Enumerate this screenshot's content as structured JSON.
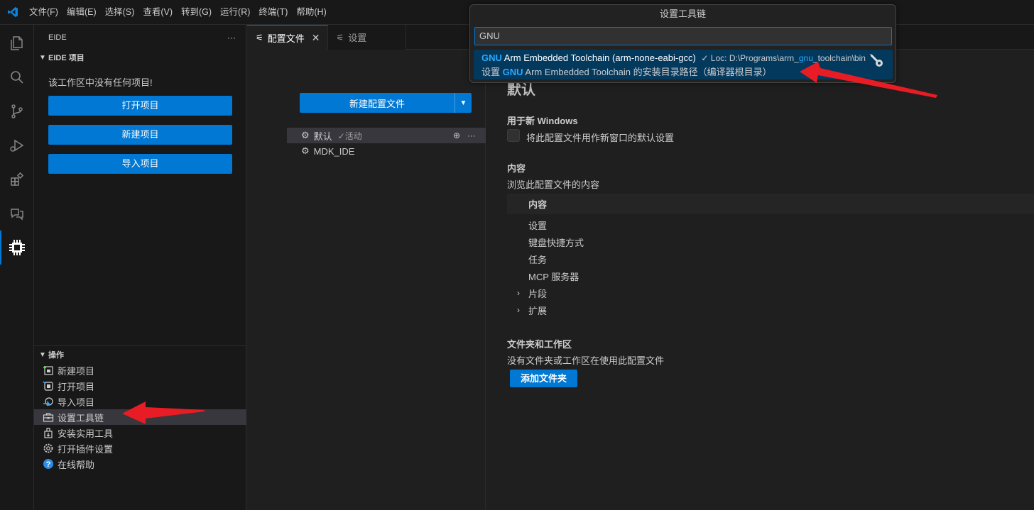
{
  "menubar": {
    "items": [
      "文件(F)",
      "编辑(E)",
      "选择(S)",
      "查看(V)",
      "转到(G)",
      "运行(R)",
      "终端(T)",
      "帮助(H)"
    ]
  },
  "activity_bar": {
    "icons": [
      "files-icon",
      "search-icon",
      "source-control-icon",
      "run-debug-icon",
      "extensions-icon",
      "chat-icon",
      "eide-chip-icon"
    ],
    "accent": "#0078d4"
  },
  "sidebar": {
    "title": "EIDE",
    "more": "···",
    "project_section": {
      "header": "EIDE 项目",
      "empty_message": "该工作区中没有任何项目!",
      "buttons": [
        "打开项目",
        "新建项目",
        "导入项目"
      ]
    },
    "ops_section": {
      "header": "操作",
      "items": [
        "新建项目",
        "打开项目",
        "导入项目",
        "设置工具链",
        "安装实用工具",
        "打开插件设置",
        "在线帮助"
      ]
    }
  },
  "editor": {
    "tabs": [
      {
        "label": "配置文件",
        "close": "✕"
      },
      {
        "label": "设置"
      }
    ],
    "profiles": {
      "new_button": "新建配置文件",
      "list": [
        {
          "name": "默认",
          "tag": "✓活动"
        },
        {
          "name": "MDK_IDE"
        }
      ],
      "row_actions": [
        "⊕",
        "···"
      ]
    },
    "details": {
      "profile_name": "默认",
      "new_windows_heading": "用于新 Windows",
      "new_windows_checkbox": "将此配置文件用作新窗口的默认设置",
      "contents_heading": "内容",
      "contents_desc": "浏览此配置文件的内容",
      "contents_table_header": "内容",
      "contents_rows": [
        "设置",
        "键盘快捷方式",
        "任务",
        "MCP 服务器",
        "片段",
        "扩展"
      ],
      "folders_heading": "文件夹和工作区",
      "folders_desc": "没有文件夹或工作区在使用此配置文件",
      "add_folder_button": "添加文件夹"
    }
  },
  "quickpick": {
    "title": "设置工具链",
    "input_value": "GNU",
    "item": {
      "label_highlight": "GNU",
      "label_rest": " Arm Embedded Toolchain (arm-none-eabi-gcc)",
      "desc_prefix": "✓ Loc: D:\\Programs\\arm_",
      "desc_highlight": "gnu",
      "desc_suffix": "_toolchain\\bin",
      "detail_prefix": "设置 ",
      "detail_highlight": "GNU",
      "detail_rest": " Arm Embedded Toolchain 的安装目录路径（编译器根目录）"
    }
  },
  "colors": {
    "accent": "#0078d4",
    "annotation_arrow": "#e81c24",
    "highlight": "#2aaaff"
  }
}
